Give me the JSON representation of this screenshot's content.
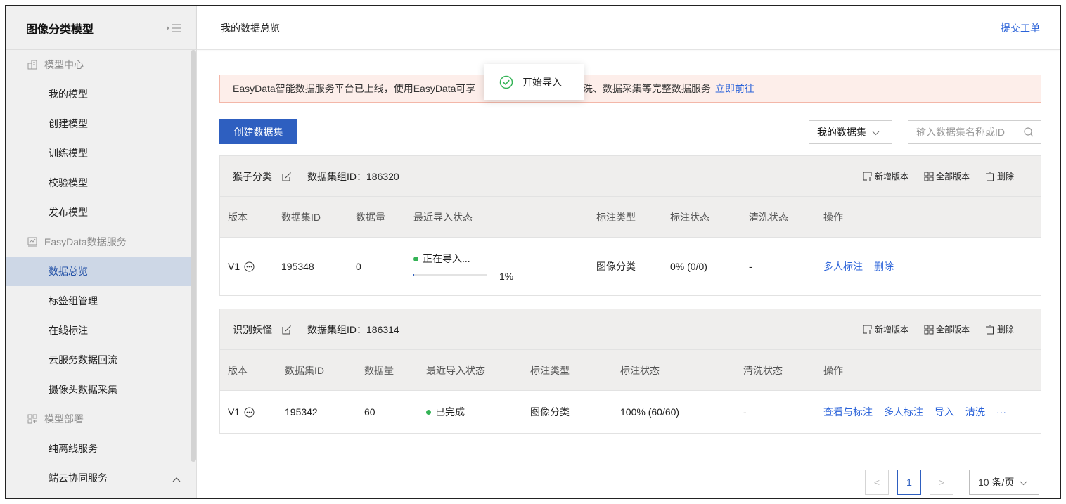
{
  "sidebar": {
    "title": "图像分类模型",
    "groups": [
      {
        "label": "模型中心",
        "icon": "building-icon",
        "items": [
          "我的模型",
          "创建模型",
          "训练模型",
          "校验模型",
          "发布模型"
        ]
      },
      {
        "label": "EasyData数据服务",
        "icon": "chart-icon",
        "items": [
          "数据总览",
          "标签组管理",
          "在线标注",
          "云服务数据回流",
          "摄像头数据采集"
        ]
      },
      {
        "label": "模型部署",
        "icon": "deploy-icon",
        "items": [
          "纯离线服务",
          "端云协同服务"
        ]
      }
    ],
    "active_item": "数据总览"
  },
  "header": {
    "breadcrumb": "我的数据总览",
    "ticket_link": "提交工单"
  },
  "banner": {
    "text": "EasyData智能数据服务平台已上线，使用EasyData可享                                据清洗、数据采集等完整数据服务",
    "link": "立即前往"
  },
  "toast": {
    "text": "开始导入"
  },
  "toolbar": {
    "create_button": "创建数据集",
    "filter_select": "我的数据集",
    "search_placeholder": "输入数据集名称或ID"
  },
  "card_actions": {
    "add_version": "新增版本",
    "all_versions": "全部版本",
    "delete": "删除"
  },
  "datasets": [
    {
      "name": "猴子分类",
      "group_id_label": "数据集组ID：186320",
      "columns": [
        "版本",
        "数据集ID",
        "数据量",
        "最近导入状态",
        "标注类型",
        "标注状态",
        "清洗状态",
        "操作"
      ],
      "row": {
        "version": "V1",
        "dataset_id": "195348",
        "count": "0",
        "import_status": "正在导入...",
        "import_progress": 1,
        "import_percent": "1%",
        "label_type": "图像分类",
        "label_status": "0% (0/0)",
        "clean_status": "-",
        "operations": [
          "多人标注",
          "删除"
        ]
      }
    },
    {
      "name": "识别妖怪",
      "group_id_label": "数据集组ID：186314",
      "columns": [
        "版本",
        "数据集ID",
        "数据量",
        "最近导入状态",
        "标注类型",
        "标注状态",
        "清洗状态",
        "操作"
      ],
      "row": {
        "version": "V1",
        "dataset_id": "195342",
        "count": "60",
        "import_status": "已完成",
        "label_type": "图像分类",
        "label_status": "100% (60/60)",
        "clean_status": "-",
        "operations": [
          "查看与标注",
          "多人标注",
          "导入",
          "清洗"
        ],
        "more": "···"
      }
    }
  ],
  "pagination": {
    "prev": "<",
    "current": "1",
    "next": ">",
    "page_size": "10 条/页"
  },
  "colors": {
    "primary": "#2e5fc0",
    "link": "#2b63d9",
    "success": "#34b356",
    "banner_bg": "#fdeeea"
  }
}
